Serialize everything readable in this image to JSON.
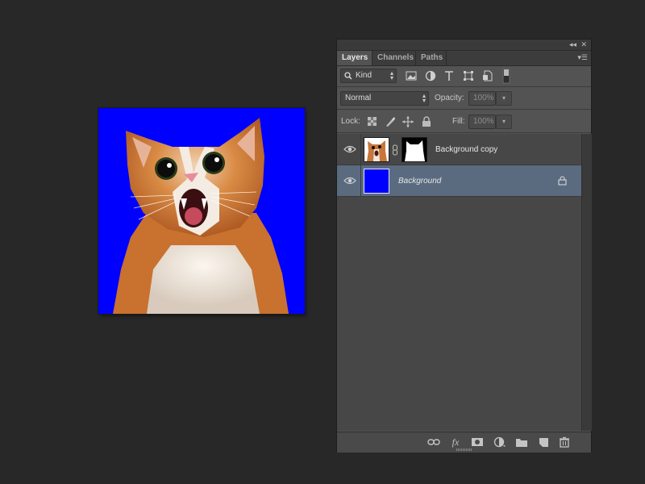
{
  "panel": {
    "tabs": [
      {
        "label": "Layers",
        "active": true
      },
      {
        "label": "Channels",
        "active": false
      },
      {
        "label": "Paths",
        "active": false
      }
    ],
    "filter": {
      "value": "Kind",
      "icon": "search-icon"
    },
    "filter_icons": [
      "image-filter-icon",
      "adjustment-filter-icon",
      "type-filter-icon",
      "shape-filter-icon",
      "smart-object-filter-icon",
      "filter-toggle-icon"
    ],
    "blend_mode": "Normal",
    "opacity_label": "Opacity:",
    "opacity_value": "100%",
    "lock_label": "Lock:",
    "fill_label": "Fill:",
    "fill_value": "100%"
  },
  "layers": [
    {
      "name": "Background copy",
      "visible": true,
      "selected": false,
      "has_mask": true,
      "italic": false
    },
    {
      "name": "Background",
      "visible": true,
      "selected": true,
      "has_mask": false,
      "italic": true,
      "locked": true,
      "fill_color": "#0000ff"
    }
  ],
  "footer_icons": [
    "link-layers-icon",
    "fx-icon",
    "add-mask-icon",
    "adjustment-layer-icon",
    "new-group-icon",
    "new-layer-icon",
    "trash-icon"
  ],
  "footer_fx": "fx",
  "colors": {
    "canvas_bg": "#0000ff",
    "selected_row": "#5a6b80",
    "app_bg": "#282828"
  }
}
